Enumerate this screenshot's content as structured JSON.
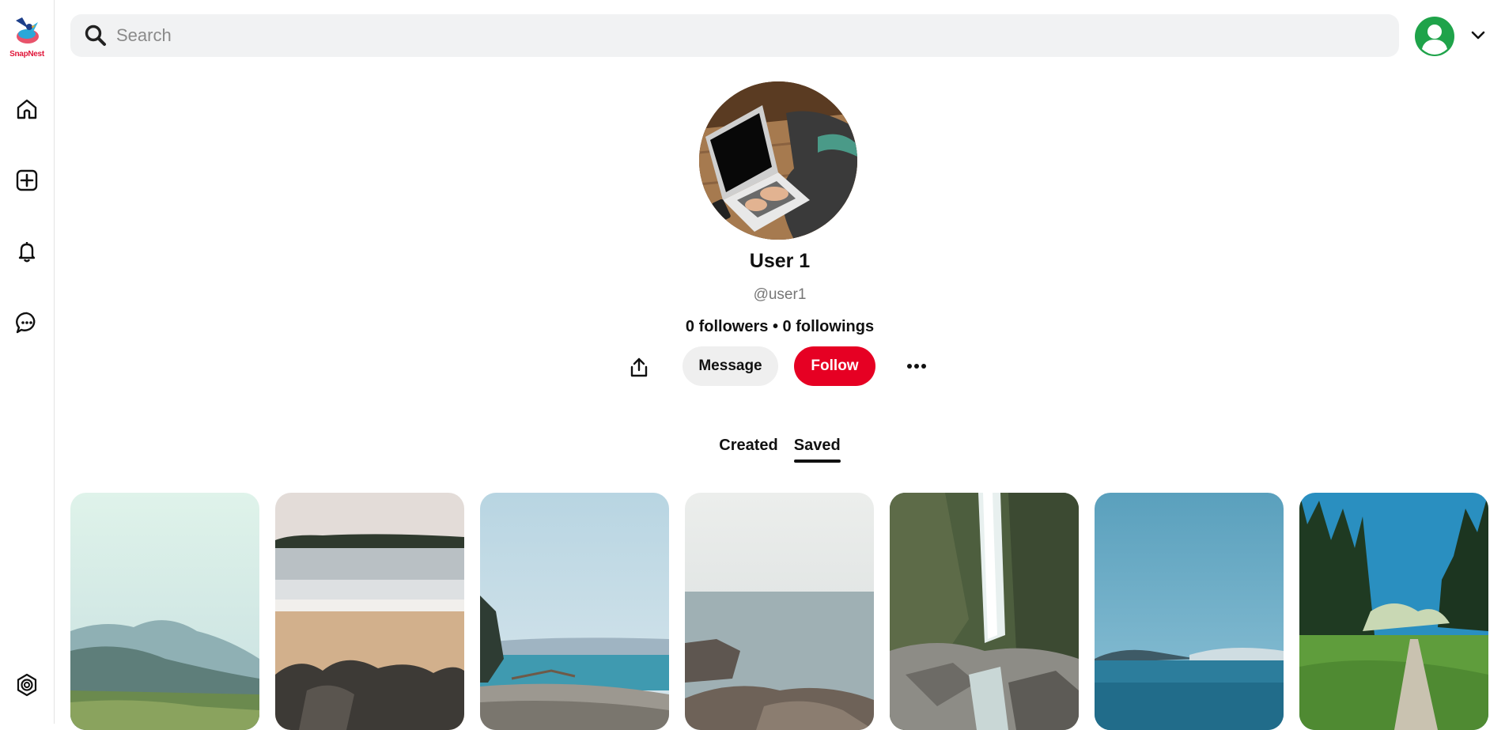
{
  "app": {
    "logo_text": "SnapNest"
  },
  "sidebar": {
    "items": [
      {
        "name": "home",
        "icon": "home-icon"
      },
      {
        "name": "create",
        "icon": "plus-square-icon"
      },
      {
        "name": "notifications",
        "icon": "bell-icon"
      },
      {
        "name": "messages",
        "icon": "chat-bubble-icon"
      },
      {
        "name": "settings",
        "icon": "settings-icon"
      }
    ]
  },
  "search": {
    "placeholder": "Search",
    "value": ""
  },
  "header": {
    "account_icon": "user-avatar-icon",
    "menu_icon": "chevron-down-icon",
    "account_color": "#1fa34a"
  },
  "profile": {
    "name": "User 1",
    "handle": "@user1",
    "stats": "0 followers • 0 followings",
    "actions": {
      "message_label": "Message",
      "follow_label": "Follow"
    }
  },
  "tabs": [
    {
      "label": "Created",
      "active": false
    },
    {
      "label": "Saved",
      "active": true
    }
  ],
  "colors": {
    "accent": "#e60023",
    "text": "#111111",
    "muted": "#767676",
    "search_bg": "#f1f2f3"
  },
  "pins": [
    {
      "subject": "misty forest hills"
    },
    {
      "subject": "rocky beach shore"
    },
    {
      "subject": "pebble beach with driftwood"
    },
    {
      "subject": "foggy sea with rocks"
    },
    {
      "subject": "waterfall in gorge"
    },
    {
      "subject": "calm blue ocean"
    },
    {
      "subject": "forest trail path"
    }
  ]
}
